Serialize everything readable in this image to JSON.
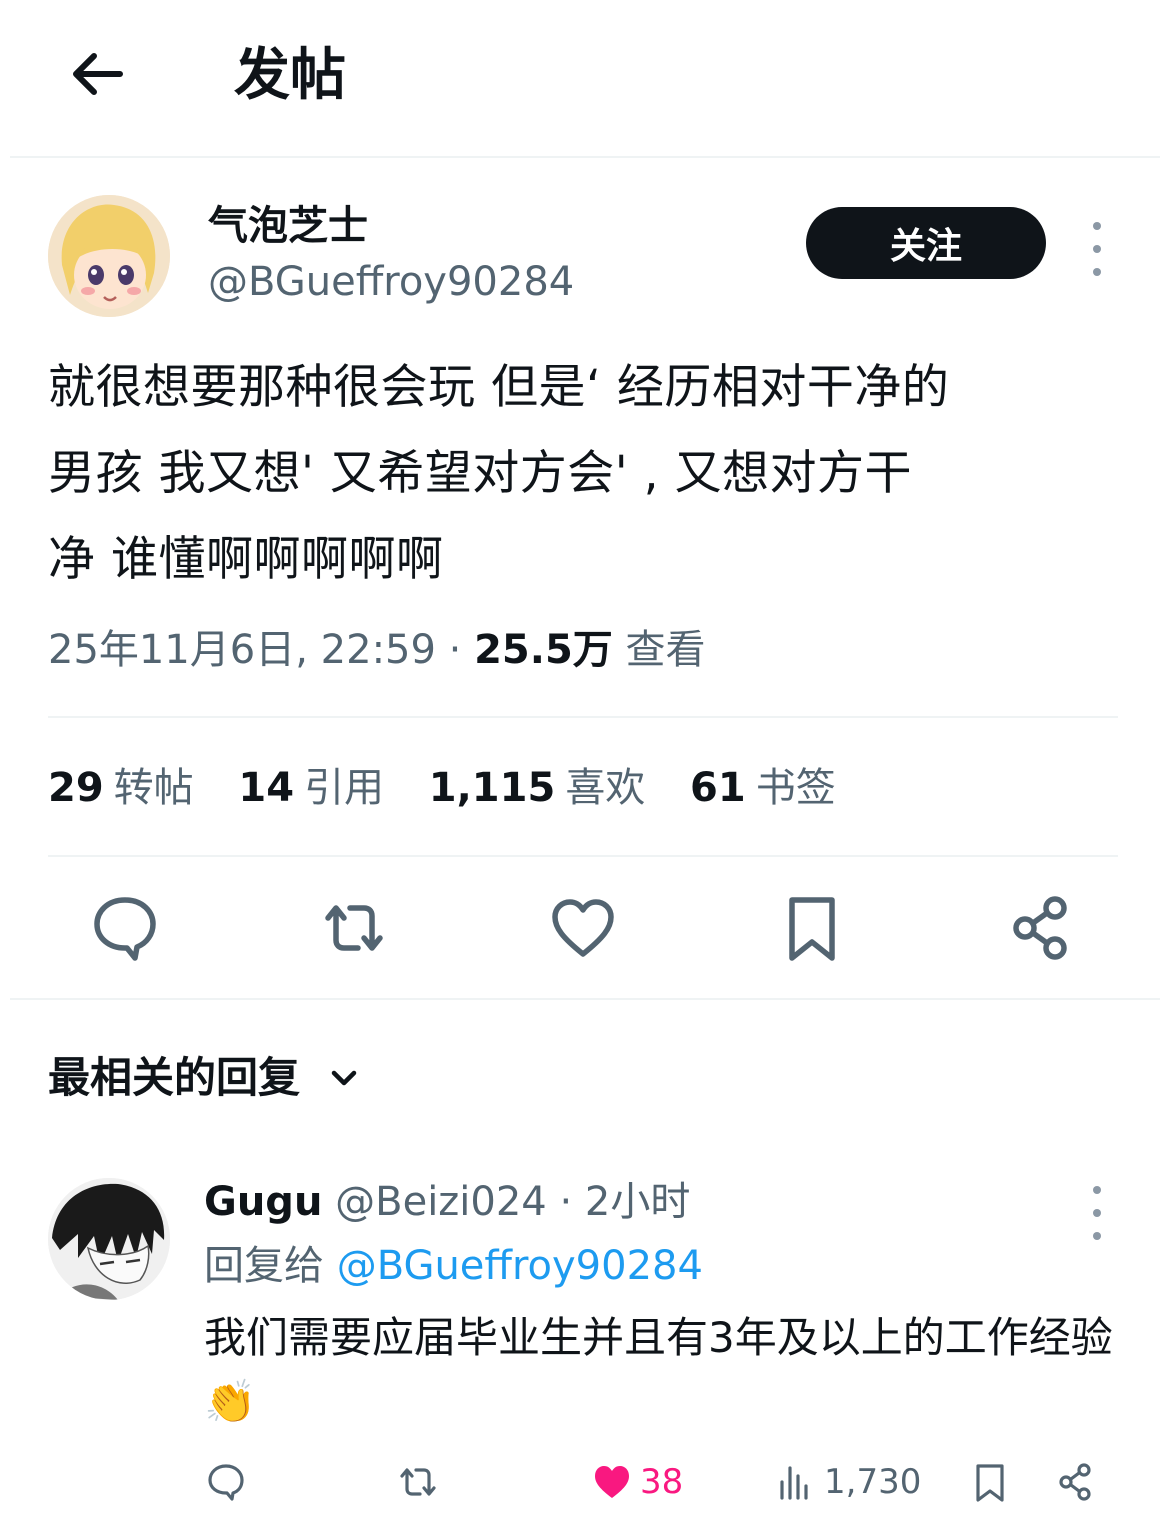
{
  "header": {
    "title": "发帖"
  },
  "post": {
    "author_name": "气泡芝士",
    "author_handle": "@BGueffroy90284",
    "follow_label": "关注",
    "text_lines": [
      "就很想要那种很会玩 但是‘  经历相对干净的",
      "男孩 我又想'    又希望对方会'  , 又想对方干",
      "净 谁懂啊啊啊啊啊"
    ],
    "date": "25年11月6日, 22:59 · ",
    "views_count": "25.5万",
    "views_label": " 查看"
  },
  "stats": [
    {
      "num": "29",
      "label": "转帖"
    },
    {
      "num": "14",
      "label": "引用"
    },
    {
      "num": "1,115",
      "label": "喜欢"
    },
    {
      "num": "61",
      "label": "书签"
    }
  ],
  "replies": {
    "sort_label": "最相关的回复",
    "reply": {
      "name": "Gugu",
      "handle_time": " @Beizi024 · 2小时",
      "reply_to_label": "回复给 ",
      "reply_to_handle": "@BGueffroy90284",
      "text": "我们需要应届毕业生并且有3年及以上的工作经验👏",
      "likes": "38",
      "views": "1,730"
    }
  },
  "colors": {
    "text": "#0f1419",
    "secondary": "#536471",
    "accent": "#1d9bf0",
    "like": "#f91880"
  },
  "icons": [
    "back-arrow-icon",
    "more-icon",
    "reply-icon",
    "repost-icon",
    "like-icon",
    "bookmark-icon",
    "share-icon",
    "chevron-down-icon",
    "views-icon"
  ]
}
